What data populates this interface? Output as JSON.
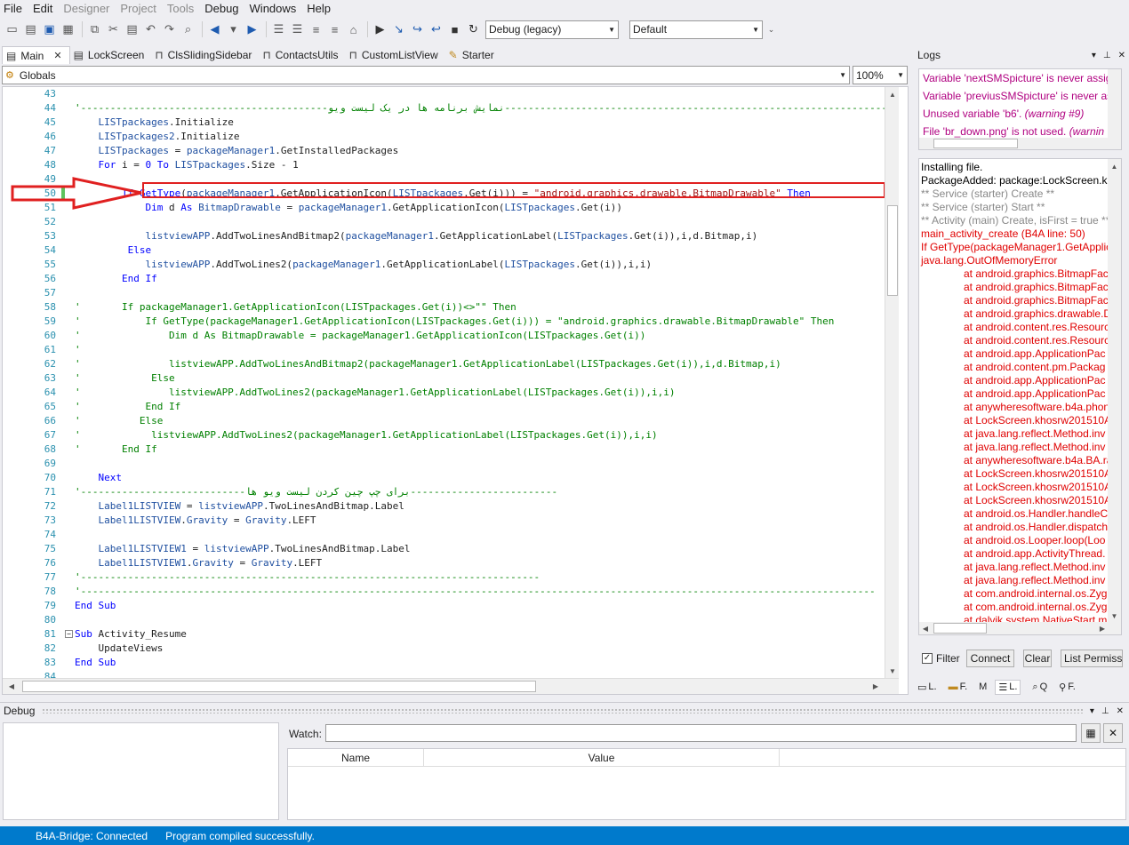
{
  "menu": [
    "File",
    "Edit",
    "Designer",
    "Project",
    "Tools",
    "Debug",
    "Windows",
    "Help"
  ],
  "menu_disabled": [
    false,
    false,
    true,
    true,
    true,
    false,
    false,
    false
  ],
  "toolbar": {
    "build_config": "Debug (legacy)",
    "device": "Default"
  },
  "tabs": [
    "Main",
    "LockScreen",
    "ClsSlidingSidebar",
    "ContactsUtils",
    "CustomListView",
    "Starter"
  ],
  "selectors": {
    "module": "Globals",
    "zoom": "100%"
  },
  "code_lines": [
    {
      "n": "43",
      "t": ""
    },
    {
      "n": "44",
      "t": "'------------------------------------------نمایش برنامه ها در یک لیست ویو-----------------------------------------------------------------------------------------------"
    },
    {
      "n": "45",
      "t": "    LISTpackages.Initialize"
    },
    {
      "n": "46",
      "t": "    LISTpackages2.Initialize"
    },
    {
      "n": "47",
      "t": "    LISTpackages = packageManager1.GetInstalledPackages"
    },
    {
      "n": "48",
      "t": "    For i = 0 To LISTpackages.Size - 1"
    },
    {
      "n": "49",
      "t": ""
    },
    {
      "n": "50",
      "t": "        If GetType(packageManager1.GetApplicationIcon(LISTpackages.Get(i))) = \"android.graphics.drawable.BitmapDrawable\" Then"
    },
    {
      "n": "51",
      "t": "            Dim d As BitmapDrawable = packageManager1.GetApplicationIcon(LISTpackages.Get(i))"
    },
    {
      "n": "52",
      "t": ""
    },
    {
      "n": "53",
      "t": "            listviewAPP.AddTwoLinesAndBitmap2(packageManager1.GetApplicationLabel(LISTpackages.Get(i)),i,d.Bitmap,i)"
    },
    {
      "n": "54",
      "t": "         Else"
    },
    {
      "n": "55",
      "t": "            listviewAPP.AddTwoLines2(packageManager1.GetApplicationLabel(LISTpackages.Get(i)),i,i)"
    },
    {
      "n": "56",
      "t": "        End If"
    },
    {
      "n": "57",
      "t": ""
    },
    {
      "n": "58",
      "t": "'       If packageManager1.GetApplicationIcon(LISTpackages.Get(i))<>\"\" Then"
    },
    {
      "n": "59",
      "t": "'           If GetType(packageManager1.GetApplicationIcon(LISTpackages.Get(i))) = \"android.graphics.drawable.BitmapDrawable\" Then"
    },
    {
      "n": "60",
      "t": "'               Dim d As BitmapDrawable = packageManager1.GetApplicationIcon(LISTpackages.Get(i))"
    },
    {
      "n": "61",
      "t": "'"
    },
    {
      "n": "62",
      "t": "'               listviewAPP.AddTwoLinesAndBitmap2(packageManager1.GetApplicationLabel(LISTpackages.Get(i)),i,d.Bitmap,i)"
    },
    {
      "n": "63",
      "t": "'            Else"
    },
    {
      "n": "64",
      "t": "'               listviewAPP.AddTwoLines2(packageManager1.GetApplicationLabel(LISTpackages.Get(i)),i,i)"
    },
    {
      "n": "65",
      "t": "'           End If"
    },
    {
      "n": "66",
      "t": "'          Else"
    },
    {
      "n": "67",
      "t": "'            listviewAPP.AddTwoLines2(packageManager1.GetApplicationLabel(LISTpackages.Get(i)),i,i)"
    },
    {
      "n": "68",
      "t": "'       End If"
    },
    {
      "n": "69",
      "t": ""
    },
    {
      "n": "70",
      "t": "    Next"
    },
    {
      "n": "71",
      "t": "'----------------------------برای چپ چین کردن لیست ویو ها-------------------------"
    },
    {
      "n": "72",
      "t": "    Label1LISTVIEW = listviewAPP.TwoLinesAndBitmap.Label"
    },
    {
      "n": "73",
      "t": "    Label1LISTVIEW.Gravity = Gravity.LEFT"
    },
    {
      "n": "74",
      "t": ""
    },
    {
      "n": "75",
      "t": "    Label1LISTVIEW1 = listviewAPP.TwoLinesAndBitmap.Label"
    },
    {
      "n": "76",
      "t": "    Label1LISTVIEW1.Gravity = Gravity.LEFT"
    },
    {
      "n": "77",
      "t": "'------------------------------------------------------------------------------"
    },
    {
      "n": "78",
      "t": "'---------------------------------------------------------------------------------------------------------------------------------------"
    },
    {
      "n": "79",
      "t": "End Sub"
    },
    {
      "n": "80",
      "t": ""
    },
    {
      "n": "81",
      "t": "Sub Activity_Resume"
    },
    {
      "n": "82",
      "t": "    UpdateViews"
    },
    {
      "n": "83",
      "t": "End Sub"
    },
    {
      "n": "84",
      "t": ""
    }
  ],
  "logs": {
    "title": "Logs",
    "warnings": [
      {
        "text": "Variable 'nextSMSpicture' is never assig",
        "tag": ""
      },
      {
        "text": "Variable 'previusSMSpicture' is never as",
        "tag": ""
      },
      {
        "text": "Unused variable 'b6'. ",
        "tag": "(warning #9)"
      },
      {
        "text": "File 'br_down.png' is not used. ",
        "tag": "(warnin"
      }
    ],
    "entries": [
      {
        "c": "n",
        "t": "Installing file."
      },
      {
        "c": "n",
        "t": "PackageAdded: package:LockScreen.kh"
      },
      {
        "c": "g",
        "t": "** Service (starter) Create **"
      },
      {
        "c": "g",
        "t": "** Service (starter) Start **"
      },
      {
        "c": "g",
        "t": "** Activity (main) Create, isFirst = true **"
      },
      {
        "c": "r",
        "t": "main_activity_create (B4A line: 50)"
      },
      {
        "c": "r",
        "t": "If GetType(packageManager1.GetApplic"
      },
      {
        "c": "r",
        "t": "java.lang.OutOfMemoryError"
      },
      {
        "c": "ri",
        "t": "at android.graphics.BitmapFac"
      },
      {
        "c": "ri",
        "t": "at android.graphics.BitmapFac"
      },
      {
        "c": "ri",
        "t": "at android.graphics.BitmapFac"
      },
      {
        "c": "ri",
        "t": "at android.graphics.drawable.D"
      },
      {
        "c": "ri",
        "t": "at android.content.res.Resourc"
      },
      {
        "c": "ri",
        "t": "at android.content.res.Resourc"
      },
      {
        "c": "ri",
        "t": "at android.app.ApplicationPac"
      },
      {
        "c": "ri",
        "t": "at android.content.pm.Packag"
      },
      {
        "c": "ri",
        "t": "at android.app.ApplicationPac"
      },
      {
        "c": "ri",
        "t": "at android.app.ApplicationPac"
      },
      {
        "c": "ri",
        "t": "at anywheresoftware.b4a.phon"
      },
      {
        "c": "ri",
        "t": "at LockScreen.khosrw201510A"
      },
      {
        "c": "ri",
        "t": "at java.lang.reflect.Method.inv"
      },
      {
        "c": "ri",
        "t": "at java.lang.reflect.Method.inv"
      },
      {
        "c": "ri",
        "t": "at anywheresoftware.b4a.BA.ra"
      },
      {
        "c": "ri",
        "t": "at LockScreen.khosrw201510A"
      },
      {
        "c": "ri",
        "t": "at LockScreen.khosrw201510A"
      },
      {
        "c": "ri",
        "t": "at LockScreen.khosrw201510A"
      },
      {
        "c": "ri",
        "t": "at android.os.Handler.handleC"
      },
      {
        "c": "ri",
        "t": "at android.os.Handler.dispatch"
      },
      {
        "c": "ri",
        "t": "at android.os.Looper.loop(Loo"
      },
      {
        "c": "ri",
        "t": "at android.app.ActivityThread."
      },
      {
        "c": "ri",
        "t": "at java.lang.reflect.Method.inv"
      },
      {
        "c": "ri",
        "t": "at java.lang.reflect.Method.inv"
      },
      {
        "c": "ri",
        "t": "at com.android.internal.os.Zyg"
      },
      {
        "c": "ri",
        "t": "at com.android.internal.os.Zyg"
      },
      {
        "c": "ri",
        "t": "at dalvik.system.NativeStart.m"
      }
    ],
    "filter_label": "Filter",
    "connect": "Connect",
    "clear": "Clear",
    "list_permissions": "List Permissi"
  },
  "bottom_tabs": [
    "L.",
    "F.",
    "M",
    "L.",
    "Q",
    "F."
  ],
  "debug": {
    "title": "Debug",
    "watch_label": "Watch:",
    "watch_value": "",
    "col_name": "Name",
    "col_value": "Value"
  },
  "status": {
    "bridge": "B4A-Bridge: Connected",
    "message": "Program compiled successfully."
  },
  "colors": {
    "accent": "#007acc",
    "highlight": "#e02020",
    "comment": "#008000",
    "keyword": "#0000ff"
  }
}
